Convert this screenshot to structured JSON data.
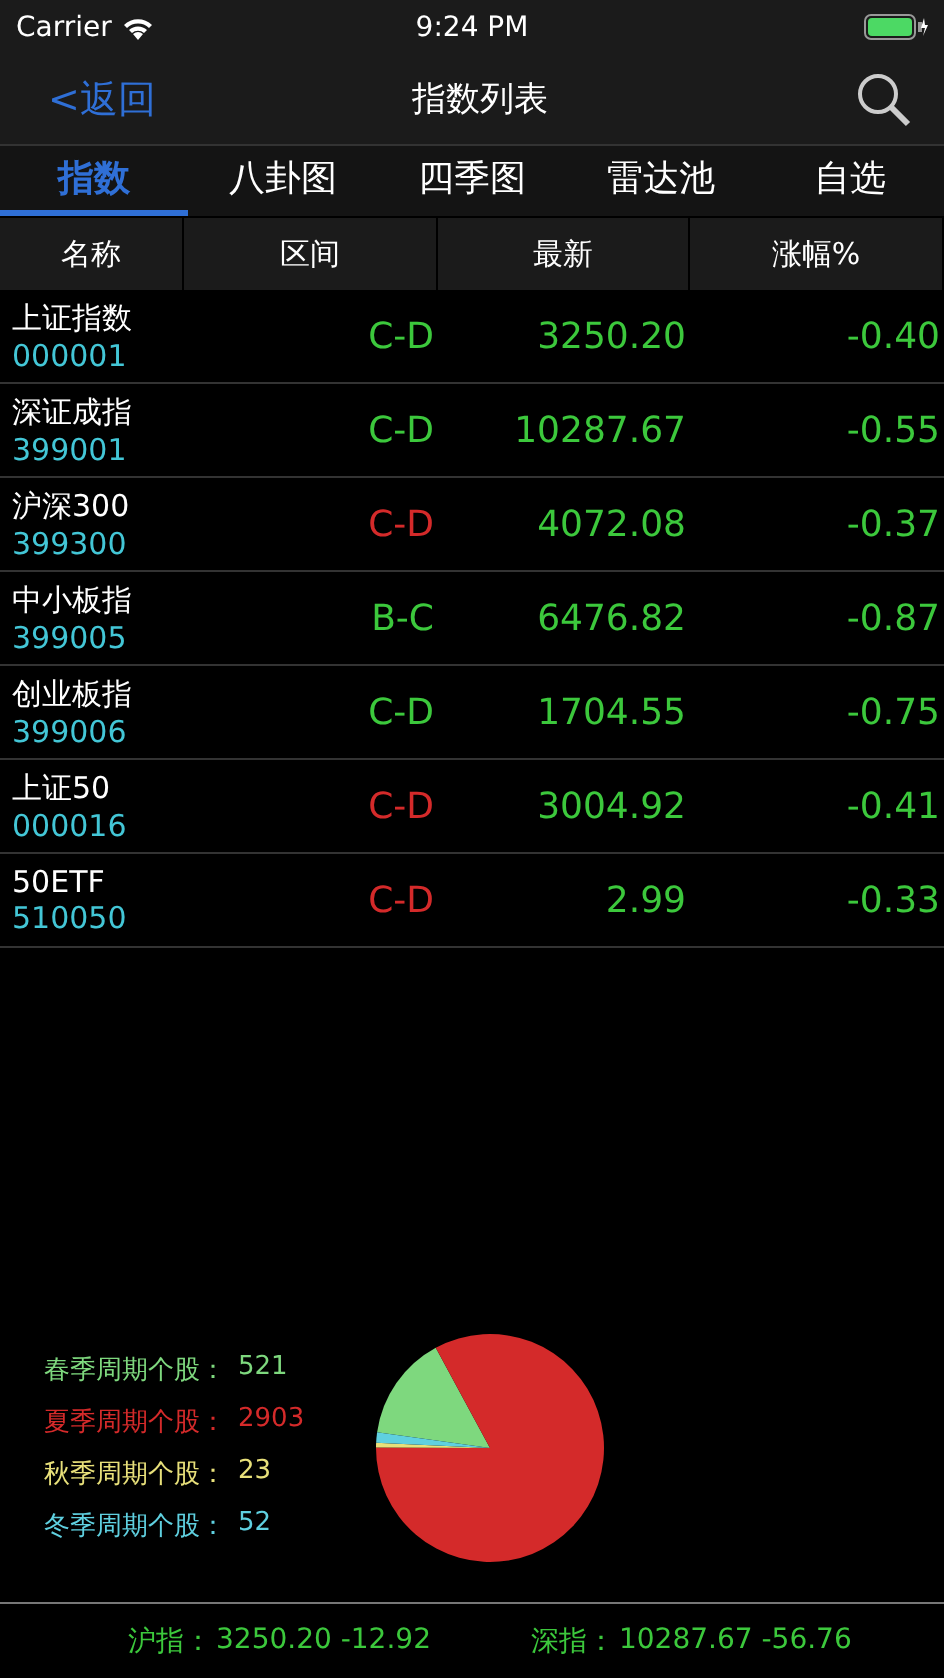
{
  "status_bar": {
    "carrier": "Carrier",
    "time": "9:24 PM"
  },
  "nav": {
    "back": "<返回",
    "title": "指数列表"
  },
  "tabs": [
    {
      "label": "指数",
      "selected": true
    },
    {
      "label": "八卦图",
      "selected": false
    },
    {
      "label": "四季图",
      "selected": false
    },
    {
      "label": "雷达池",
      "selected": false
    },
    {
      "label": "自选",
      "selected": false
    }
  ],
  "table": {
    "columns": [
      "名称",
      "区间",
      "最新",
      "涨幅%"
    ],
    "rows": [
      {
        "name": "上证指数",
        "code": "000001",
        "range": "C-D",
        "color": "#3cc83c",
        "latest": "3250.20",
        "change": "-0.40"
      },
      {
        "name": "深证成指",
        "code": "399001",
        "range": "C-D",
        "color": "#3cc83c",
        "latest": "10287.67",
        "change": "-0.55"
      },
      {
        "name": "沪深300",
        "code": "399300",
        "range": "C-D",
        "color": "#d42a2a",
        "latest": "4072.08",
        "change": "-0.37"
      },
      {
        "name": "中小板指",
        "code": "399005",
        "range": "B-C",
        "color": "#3cc83c",
        "latest": "6476.82",
        "change": "-0.87"
      },
      {
        "name": "创业板指",
        "code": "399006",
        "range": "C-D",
        "color": "#3cc83c",
        "latest": "1704.55",
        "change": "-0.75"
      },
      {
        "name": "上证50",
        "code": "000016",
        "range": "C-D",
        "color": "#d42a2a",
        "latest": "3004.92",
        "change": "-0.41"
      },
      {
        "name": "50ETF",
        "code": "510050",
        "range": "C-D",
        "color": "#d42a2a",
        "latest": "2.99",
        "change": "-0.33"
      }
    ]
  },
  "seasons": {
    "legend": [
      {
        "label": "春季周期个股：",
        "value": "521",
        "color": "#7ed87e"
      },
      {
        "label": "夏季周期个股：",
        "value": "2903",
        "color": "#d42a2a"
      },
      {
        "label": "秋季周期个股：",
        "value": "23",
        "color": "#e8e07a"
      },
      {
        "label": "冬季周期个股：",
        "value": "52",
        "color": "#5fd0e0"
      }
    ]
  },
  "footer": [
    {
      "label": "沪指：",
      "value": "3250.20 -12.92"
    },
    {
      "label": "深指：",
      "value": "10287.67 -56.76"
    }
  ]
}
